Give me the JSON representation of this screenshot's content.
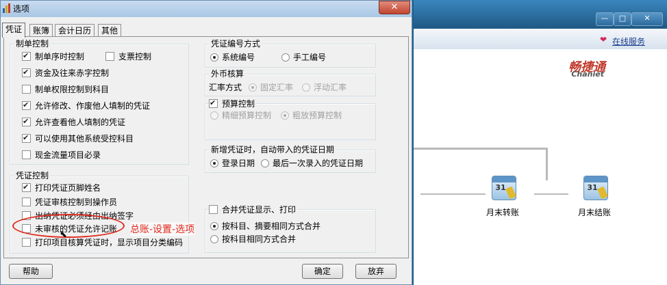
{
  "dialog": {
    "title": "选项",
    "close_label": "✕",
    "tabs": [
      {
        "label": "凭证",
        "active": true
      },
      {
        "label": "账簿",
        "active": false
      },
      {
        "label": "会计日历",
        "active": false
      },
      {
        "label": "其他",
        "active": false
      }
    ],
    "zhidan": {
      "title": "制单控制",
      "items": [
        {
          "label": "制单序时控制",
          "checked": true
        },
        {
          "label": "支票控制",
          "checked": false
        },
        {
          "label": "资金及往来赤字控制",
          "checked": true
        },
        {
          "label": "制单权限控制到科目",
          "checked": false
        },
        {
          "label": "允许修改、作废他人填制的凭证",
          "checked": true
        },
        {
          "label": "允许查看他人填制的凭证",
          "checked": true
        },
        {
          "label": "可以使用其他系统受控科目",
          "checked": true
        },
        {
          "label": "现金流量项目必录",
          "checked": false
        }
      ]
    },
    "pingzheng": {
      "title": "凭证控制",
      "items": [
        {
          "label": "打印凭证页脚姓名",
          "checked": true
        },
        {
          "label": "凭证审核控制到操作员",
          "checked": false
        },
        {
          "label": "出纳凭证必须经由出纳签字",
          "checked": false
        },
        {
          "label": "未审核的凭证允许记账",
          "checked": false
        },
        {
          "label": "打印项目核算凭证时，显示项目分类编码",
          "checked": false
        }
      ]
    },
    "bianhao": {
      "title": "凭证编号方式",
      "options": [
        {
          "label": "系统编号",
          "checked": true
        },
        {
          "label": "手工编号",
          "checked": false
        }
      ]
    },
    "waibi": {
      "title": "外币核算",
      "rate_label": "汇率方式",
      "options": [
        {
          "label": "固定汇率",
          "checked": true
        },
        {
          "label": "浮动汇率",
          "checked": false
        }
      ]
    },
    "yusuan": {
      "title": "预算控制",
      "checked": true,
      "options": [
        {
          "label": "精细预算控制",
          "checked": false
        },
        {
          "label": "粗放预算控制",
          "checked": true
        }
      ]
    },
    "xinzeng": {
      "title": "新增凭证时，自动带入的凭证日期",
      "options": [
        {
          "label": "登录日期",
          "checked": true
        },
        {
          "label": "最后一次录入的凭证日期",
          "checked": false
        }
      ]
    },
    "hebing": {
      "title": "合并凭证显示、打印",
      "checked": false,
      "options": [
        {
          "label": "按科目、摘要相同方式合并",
          "checked": true
        },
        {
          "label": "按科目相同方式合并",
          "checked": false
        }
      ]
    },
    "buttons": {
      "help": "帮助",
      "ok": "确定",
      "cancel": "放弃"
    }
  },
  "annotation": {
    "text": "总账-设置-选项",
    "color": "#e0281c"
  },
  "background_app": {
    "window_buttons": [
      "—",
      "□",
      "✕"
    ],
    "online_service": "在线服务",
    "brand_cn": "畅捷通",
    "brand_en": "Chanjet",
    "flow_steps": [
      {
        "label": "月末转账",
        "date": "31"
      },
      {
        "label": "月末结账",
        "date": "31"
      }
    ]
  }
}
